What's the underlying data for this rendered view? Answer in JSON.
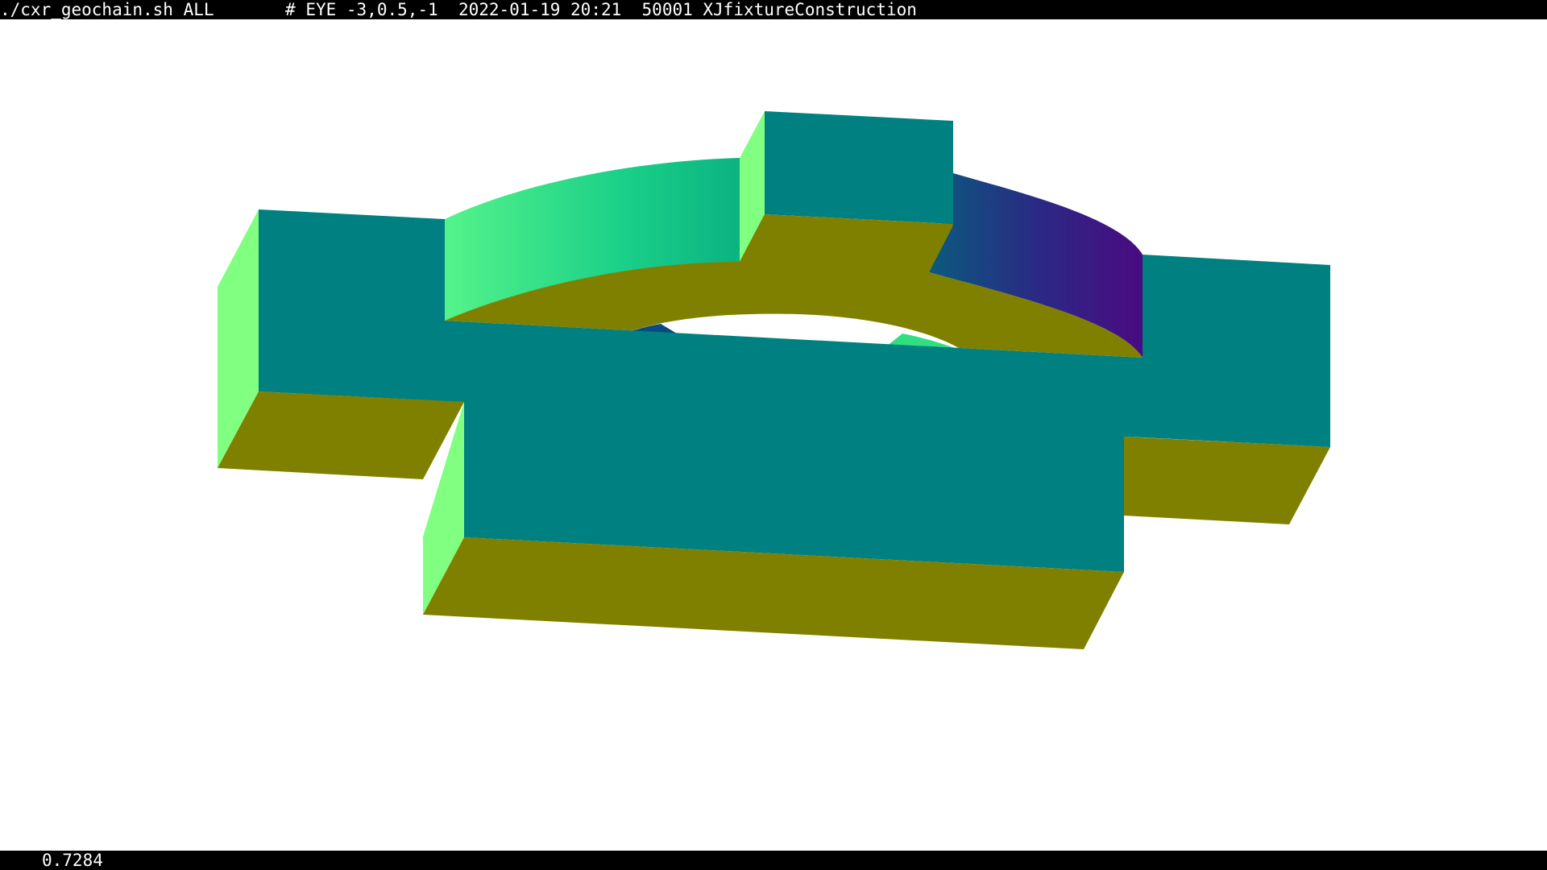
{
  "window": {
    "command": "./cxr_geochain.sh ALL",
    "header": "# EYE -3,0.5,-1  2022-01-19 20:21  50001 XJfixtureConstruction"
  },
  "status": {
    "value": "0.7284"
  },
  "scene": {
    "object": "fixture-construction",
    "colors": {
      "front_face": "#008080",
      "top_face": "#808000",
      "side_face": "#80ff80",
      "ring_outer_light": "#50f090",
      "ring_outer_mid": "#10c080",
      "ring_outer_dark": "#0a4a80",
      "ring_outer_violet": "#4a0a80",
      "background": "#ffffff"
    }
  }
}
